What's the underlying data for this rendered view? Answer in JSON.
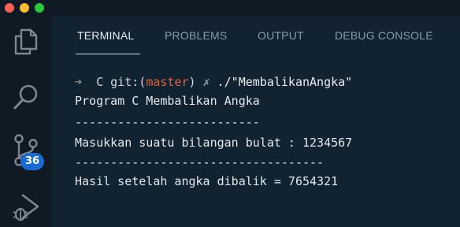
{
  "window": {
    "controls": [
      "close",
      "minimize",
      "maximize"
    ]
  },
  "activity_bar": {
    "items": [
      {
        "icon": "files-icon"
      },
      {
        "icon": "search-icon"
      },
      {
        "icon": "source-control-icon",
        "badge": "36"
      },
      {
        "icon": "run-debug-icon"
      }
    ]
  },
  "panel": {
    "tabs": [
      {
        "label": "TERMINAL",
        "active": true
      },
      {
        "label": "PROBLEMS",
        "active": false
      },
      {
        "label": "OUTPUT",
        "active": false
      },
      {
        "label": "DEBUG CONSOLE",
        "active": false
      }
    ]
  },
  "terminal": {
    "prompt": {
      "arrow": "➜",
      "dir": "C",
      "git_prefix": "git:(",
      "branch": "master",
      "git_suffix": ")",
      "dirty_mark": "✗",
      "command": "./\"MembalikanAngka\""
    },
    "output": [
      "Program C Membalikan Angka",
      "--------------------------",
      "Masukkan suatu bilangan bulat : 1234567",
      "-----------------------------------",
      "Hasil setelah angka dibalik = 7654321"
    ]
  },
  "colors": {
    "background": "#112330",
    "activity_bar": "#0f1a24",
    "badge": "#1a6ad3",
    "branch": "#e0603c",
    "text": "#e3e8ec",
    "inactive_tab": "#8c9aa6"
  }
}
